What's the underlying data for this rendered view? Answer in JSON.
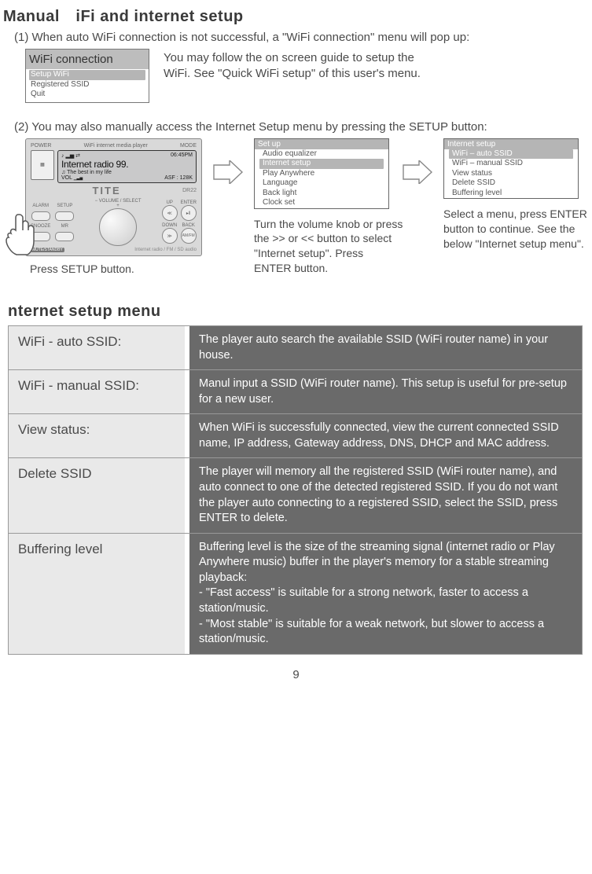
{
  "title": "Manual iFi and internet setup",
  "step1_text": "(1) When auto WiFi connection is not successful, a \"WiFi connection\" menu will pop up:",
  "wifi_conn": {
    "title": "WiFi connection",
    "items": [
      "Setup WiFi",
      "Registered SSID",
      "Quit"
    ],
    "highlight_index": 0
  },
  "guide_text_line1": "You may follow the on screen guide to setup the",
  "guide_text_line2": "WiFi. See \"Quick WiFi setup\" of this user's menu.",
  "step2_text": "(2) You may also manually access the Internet Setup menu by pressing the SETUP button:",
  "device": {
    "header_label": "WiFi internet media player",
    "power": "POWER",
    "mode": "MODE",
    "screen_time": "06:45PM",
    "screen_main": "Internet radio 99.",
    "screen_sub": "The best in my life",
    "screen_vol": "VOL",
    "screen_asf": "ASF : 128K",
    "brand": "TITE",
    "model": "DR22",
    "alarm": "ALARM",
    "setup": "SETUP",
    "mr": "MR",
    "snooze": "SNOOZE",
    "up": "UP",
    "enter": "ENTER",
    "down": "DOWN",
    "back": "BACK",
    "volsel": "VOLUME / SELECT",
    "mute": "MUTE/STANDBY",
    "footer": "Internet radio / FM / SD audio"
  },
  "press_setup": "Press SETUP button.",
  "setup_menu": {
    "header": "Set up",
    "items": [
      "Audio equalizer",
      "Internet setup",
      "Play Anywhere",
      "Language",
      "Back light",
      "Clock set"
    ],
    "highlight_index": 1
  },
  "setup_caption": "Turn the volume knob or press the >> or << button to select \"Internet setup\". Press ENTER button.",
  "internet_menu": {
    "header": "Internet setup",
    "items": [
      "WiFi – auto SSID",
      "WiFi – manual SSID",
      "View status",
      "Delete SSID",
      "Buffering level"
    ],
    "highlight_index": 0
  },
  "internet_caption": "Select a menu, press ENTER button to continue. See the below \"Internet setup menu\".",
  "section_title": "nternet setup menu",
  "table": [
    {
      "label": "WiFi - auto SSID:",
      "desc": "The player auto search the available SSID (WiFi router name) in your house."
    },
    {
      "label": "WiFi - manual SSID:",
      "desc": "Manul input a SSID (WiFi router name). This  setup is useful for pre-setup for a new user."
    },
    {
      "label": "View status:",
      "desc": "When WiFi is successfully connected, view the current connected SSID name, IP address, Gateway address, DNS, DHCP and MAC address."
    },
    {
      "label": "Delete SSID",
      "desc": "The player will memory all the registered SSID (WiFi router name), and auto connect to one of the detected registered SSID. If you do not want the player auto connecting to a registered SSID, select the SSID, press ENTER to delete."
    },
    {
      "label": "Buffering level",
      "desc": "Buffering level is the size of the streaming signal (internet radio or Play Anywhere music) buffer in the player's memory for a stable streaming playback:\n- \"Fast access\" is suitable for a strong network, faster to access a station/music.\n- \"Most stable\" is suitable for a weak network, but slower to access a station/music."
    }
  ],
  "page_number": "9"
}
